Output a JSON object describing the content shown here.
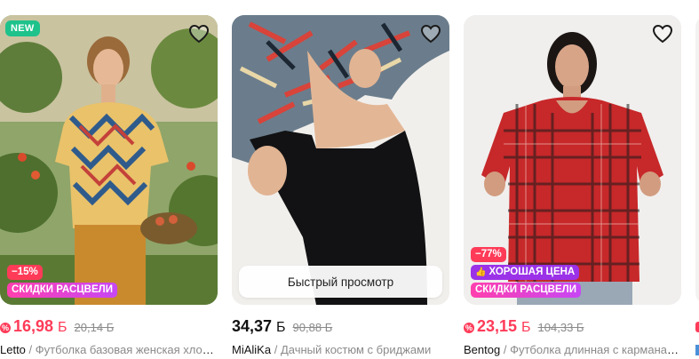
{
  "products": [
    {
      "new_badge": "NEW",
      "discount_badge": "−15%",
      "promo_badge": "СКИДКИ РАСЦВЕЛИ",
      "price": "16,98",
      "currency": "Б",
      "old_price": "20,14 Б",
      "brand": "Letto",
      "separator": "/",
      "title": "Футболка базовая женская хлопок"
    },
    {
      "quick_view_label": "Быстрый просмотр",
      "price": "34,37",
      "currency": "Б",
      "old_price": "90,88 Б",
      "brand": "MiAliKa",
      "separator": "/",
      "title": "Дачный костюм с бриджами"
    },
    {
      "discount_badge": "−77%",
      "good_price_badge": "ХОРОШАЯ ЦЕНА",
      "promo_badge": "СКИДКИ РАСЦВЕЛИ",
      "price": "23,15",
      "currency": "Б",
      "old_price": "104,33 Б",
      "brand": "Bentog",
      "separator": "/",
      "title": "Футболка длинная с карманами"
    }
  ],
  "colors": {
    "sale_red": "#ff3b58",
    "new_green": "#1ec28b",
    "promo_pink": "#ff3fae",
    "good_purple": "#9b32e8"
  },
  "icons": [
    "heart-icon",
    "sale-price-icon",
    "thumbs-up-icon"
  ]
}
